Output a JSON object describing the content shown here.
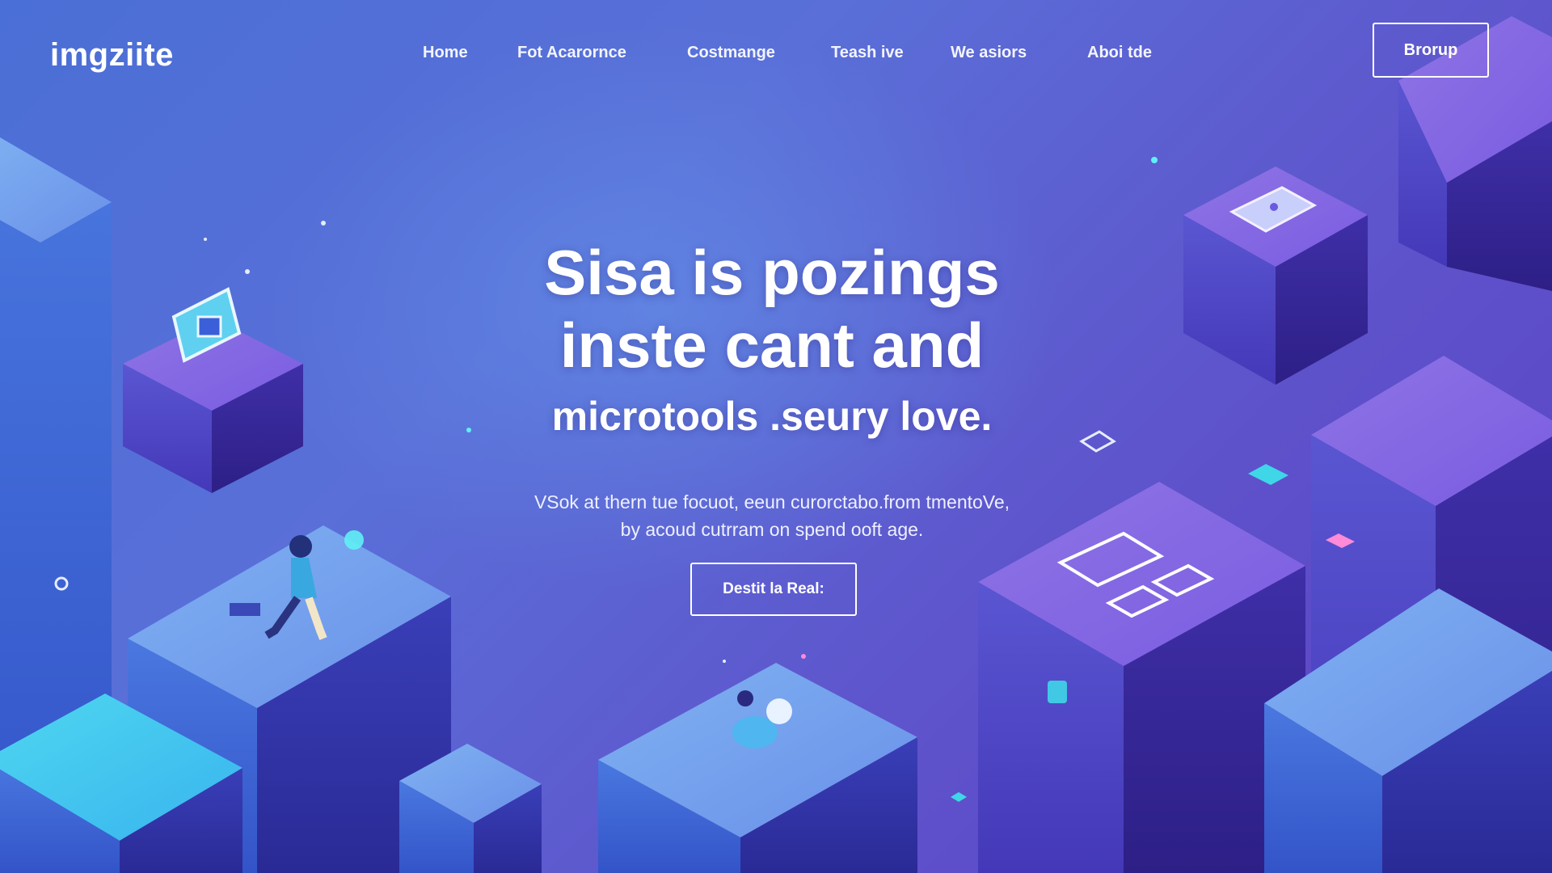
{
  "header": {
    "logo_text": "imgziite",
    "nav_items": [
      "Home",
      "Fot Acarornce",
      "Costmange",
      "Teash ive",
      "We asiors",
      "Aboi tde"
    ],
    "signup_label": "Brorup"
  },
  "hero": {
    "title_line_1": "Sisa is pozings",
    "title_line_2": "inste cant and",
    "title_line_3": "microtools .seury love.",
    "subtitle_line_1": "VSok at thern tue focuot, eeun curorctabo.from tmentoVe,",
    "subtitle_line_2": "by acoud cutrram on spend ooft age.",
    "cta_label": "Destit la Real:"
  },
  "colors": {
    "bg_blue": "#4a6fd6",
    "bg_purple": "#5b3fc2",
    "accent_cyan": "#3fd6e8",
    "accent_pink": "#ff6fc8"
  }
}
